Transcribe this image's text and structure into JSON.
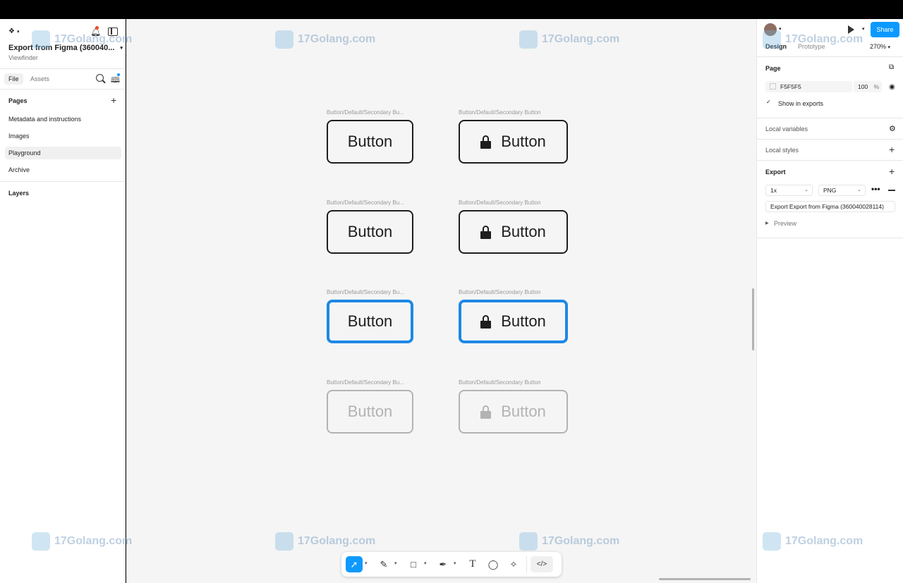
{
  "left_panel": {
    "file_name": "Export from Figma (360040...",
    "subtitle": "Viewfinder",
    "tabs": [
      "File",
      "Assets"
    ],
    "pages_heading": "Pages",
    "pages": [
      "Metadata and instructions",
      "Images",
      "Playground",
      "Archive"
    ],
    "selected_page": "Playground",
    "layers_heading": "Layers"
  },
  "canvas": {
    "background": "#F5F5F5",
    "frames": [
      {
        "label": "Button/Default/Secondary Bu...",
        "text": "Button",
        "state": "default",
        "lock": false
      },
      {
        "label": "Button/Default/Secondary Button",
        "text": "Button",
        "state": "default",
        "lock": true
      },
      {
        "label": "Button/Default/Secondary Bu...",
        "text": "Button",
        "state": "default",
        "lock": false
      },
      {
        "label": "Button/Default/Secondary Button",
        "text": "Button",
        "state": "default",
        "lock": true
      },
      {
        "label": "Button/Default/Secondary Bu...",
        "text": "Button",
        "state": "focus",
        "lock": false
      },
      {
        "label": "Button/Default/Secondary Button",
        "text": "Button",
        "state": "focus",
        "lock": true
      },
      {
        "label": "Button/Default/Secondary Bu...",
        "text": "Button",
        "state": "disabled",
        "lock": false
      },
      {
        "label": "Button/Default/Secondary Button",
        "text": "Button",
        "state": "disabled",
        "lock": true
      }
    ]
  },
  "right_panel": {
    "share_label": "Share",
    "tabs": [
      "Design",
      "Prototype"
    ],
    "zoom": "270%",
    "page_heading": "Page",
    "page_color": "F5F5F5",
    "page_opacity": "100",
    "opacity_unit": "%",
    "show_in_exports": "Show in exports",
    "local_variables": "Local variables",
    "local_styles": "Local styles",
    "export_heading": "Export",
    "export_scale": "1x",
    "export_format": "PNG",
    "export_button": "Export Export from Figma (360040028114)",
    "preview_label": "Preview"
  },
  "help_label": "?",
  "watermark": {
    "text": "17Golang.com"
  },
  "colors": {
    "accent": "#0D99FF",
    "focus_ring": "#1E88E5",
    "disabled": "#B3B3B3"
  }
}
